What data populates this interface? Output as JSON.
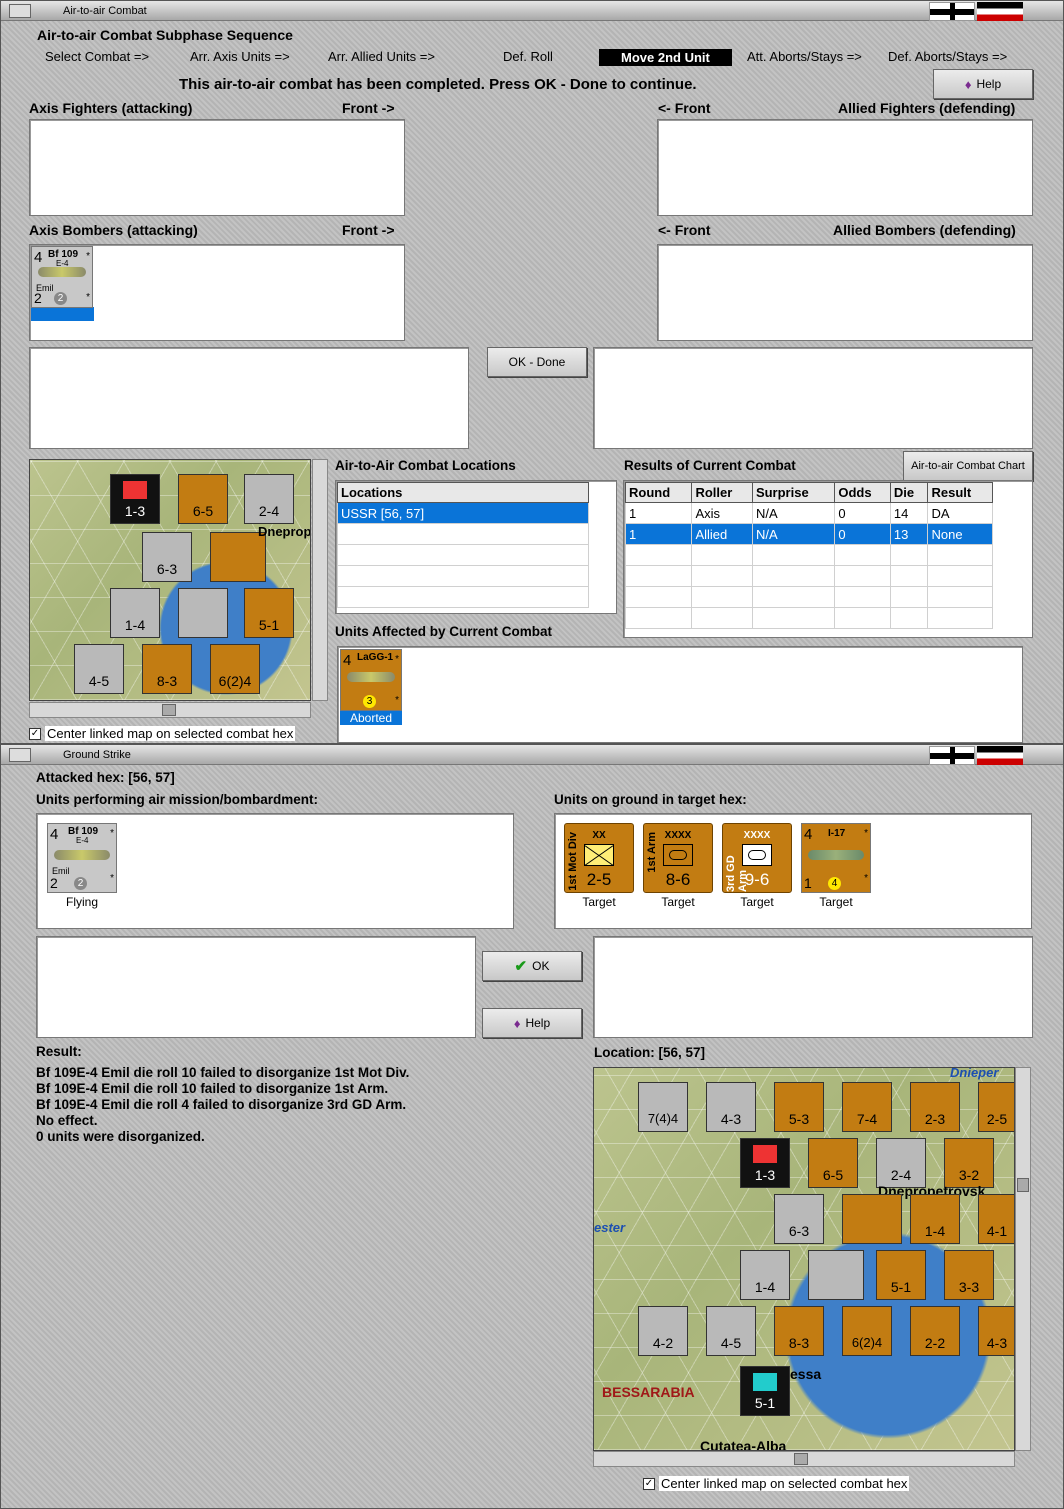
{
  "win1": {
    "title": "Air-to-air Combat",
    "subphase_title": "Air-to-air Combat Subphase Sequence",
    "sequence": [
      "Select Combat =>",
      "Arr. Axis Units =>",
      "Arr. Allied Units =>",
      "Def. Roll",
      "Move 2nd Unit",
      "Att. Aborts/Stays =>",
      "Def. Aborts/Stays =>"
    ],
    "message": "This air-to-air combat has been completed.  Press OK - Done to continue.",
    "help_label": "Help",
    "axis_fighters": "Axis Fighters (attacking)",
    "front_right": "Front ->",
    "front_left": "<- Front",
    "allied_fighters": "Allied Fighters (defending)",
    "axis_bombers": "Axis Bombers (attacking)",
    "allied_bombers": "Allied Bombers (defending)",
    "ok_done_label": "OK - Done",
    "locations_title": "Air-to-Air Combat Locations",
    "locations_header": "Locations",
    "locations": [
      "USSR [56, 57]"
    ],
    "results_title": "Results of Current Combat",
    "chart_button": "Air-to-air Combat Chart",
    "results_headers": [
      "Round",
      "Roller",
      "Surprise",
      "Odds",
      "Die",
      "Result"
    ],
    "results_rows": [
      [
        "1",
        "Axis",
        "N/A",
        "0",
        "14",
        "DA"
      ],
      [
        "1",
        "Allied",
        "N/A",
        "0",
        "13",
        "None"
      ]
    ],
    "affected_title": "Units Affected by Current Combat",
    "affected_status": "Aborted",
    "center_map": "Center linked map on selected combat hex",
    "map_label": "Dnepropetrovsk"
  },
  "axis_unit": {
    "n1": "4",
    "name": "Bf 109",
    "sub": "E-4",
    "nick": "Emil",
    "n2": "2",
    "circle": "2",
    "star": "*"
  },
  "lagg_unit": {
    "n1": "4",
    "name": "LaGG-1",
    "circle": "3",
    "star": "*"
  },
  "win2": {
    "title": "Ground Strike",
    "attacked_hex": "Attacked hex:  [56, 57]",
    "units_air": "Units performing air mission/bombardment:",
    "units_ground": "Units on ground in target hex:",
    "flying": "Flying",
    "ok_label": "OK",
    "help_label": "Help",
    "result_label": "Result:",
    "result_lines": [
      "Bf 109E-4 Emil die roll 10 failed to disorganize 1st Mot Div.",
      "Bf 109E-4 Emil die roll 10 failed to disorganize 1st Arm.",
      "Bf 109E-4 Emil die roll 4 failed to disorganize 3rd GD Arm.",
      "No effect.",
      "0 units were disorganized."
    ],
    "location_label": "Location:   [56, 57]",
    "center_map": "Center linked map on selected combat hex",
    "ground_units": [
      {
        "side": "1st Mot Div",
        "type": "XX",
        "str": "2-5",
        "cap": "Target"
      },
      {
        "side": "1st Arm",
        "type": "XXXX",
        "str": "8-6",
        "cap": "Target"
      },
      {
        "side": "3rd GD Arm",
        "type": "XXXX",
        "str": "9-6",
        "cap": "Target"
      },
      {
        "side": "",
        "type": "I-17",
        "str": "1",
        "cap": "Target"
      }
    ],
    "i17": {
      "n1": "4",
      "circle": "4",
      "star": "*"
    },
    "map_labels": {
      "bess": "BESSARABIA",
      "city": "Cutatea-Alba",
      "odessa": "essa",
      "dnepr": "Dnepropetrovsk",
      "river": "Dnieper",
      "ester": "ester"
    }
  },
  "colors": {
    "accent": "#0a74d8",
    "counter_orange": "#c27c12",
    "counter_gray": "#b9b9b9"
  }
}
